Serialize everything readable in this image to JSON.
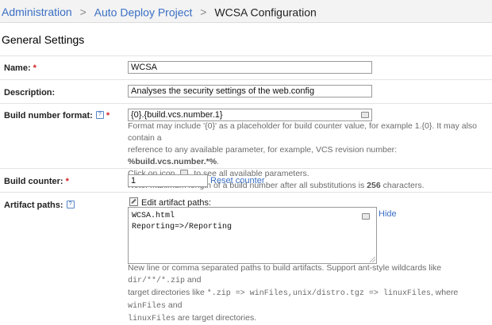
{
  "breadcrumb": {
    "items": [
      "Administration",
      "Auto Deploy Project",
      "WCSA Configuration"
    ],
    "separator": ">"
  },
  "section": {
    "title": "General Settings"
  },
  "fields": {
    "required_mark": "*",
    "help_glyph": "?",
    "name": {
      "label": "Name:",
      "value": "WCSA"
    },
    "description": {
      "label": "Description:",
      "value": "Analyses the security settings of the web.config"
    },
    "build_number_format": {
      "label": "Build number format:",
      "value": "{0}.{build.vcs.number.1}",
      "note1": "Format may include '{0}' as a placeholder for build counter value, for example 1.{0}. It may also contain a",
      "note2_pre": "reference to any available parameter, for example, VCS revision number: ",
      "note2_bold": "%build.vcs.number.*%",
      "note2_post": ".",
      "note3_pre": "Click on icon",
      "note3_post": "to see all available parameters.",
      "note4_pre": "Note: maximum length of a build number after all substitutions is ",
      "note4_bold": "256",
      "note4_post": " characters."
    },
    "build_counter": {
      "label": "Build counter:",
      "value": "1",
      "reset_label": "Reset counter"
    },
    "artifact_paths": {
      "label": "Artifact paths:",
      "edit_label": "Edit artifact paths:",
      "line1": "WCSA.html",
      "line2": "Reporting=>/Reporting",
      "hide_label": "Hide",
      "help_a1": "New line or comma separated paths to build artifacts. Support ant-style wildcards like ",
      "help_a2": "dir/**/*.zip",
      "help_a3": " and",
      "help_b1": "target directories like ",
      "help_b2": "*.zip => winFiles,unix/distro.tgz => linuxFiles",
      "help_b3": ", where ",
      "help_b4": "winFiles",
      "help_b5": " and",
      "help_c1": "linuxFiles",
      "help_c2": " are target directories."
    }
  },
  "colors": {
    "link": "#3a6fc4",
    "required": "#d21f1f",
    "note": "#6b6b6b"
  }
}
